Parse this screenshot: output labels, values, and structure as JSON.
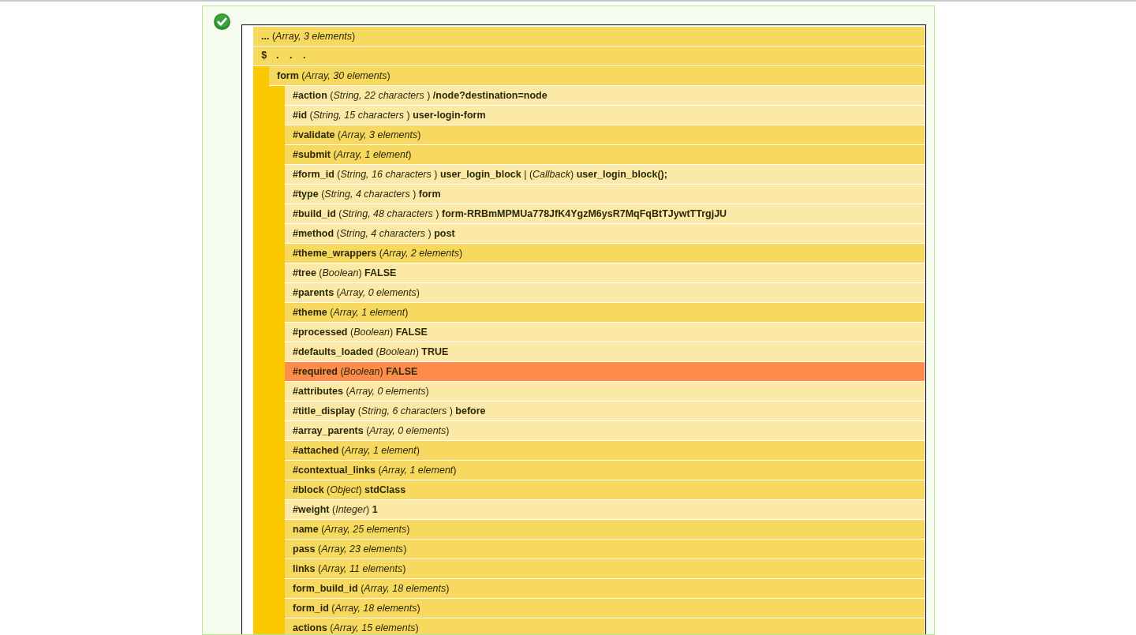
{
  "status": {
    "kind": "success"
  },
  "tree": [
    {
      "label": "**...** (*Array, 3 elements*)",
      "kind": "expandable",
      "highlighted": false
    },
    {
      "label": "$ . . .",
      "kind": "path",
      "highlighted": false,
      "children": [
        {
          "label": "**form** (*Array, 30 elements*)",
          "kind": "expandable",
          "highlighted": false,
          "children": [
            {
              "label": "**#action** (*String, 22 characters* ) **/node?destination=node**",
              "kind": "value",
              "highlighted": false
            },
            {
              "label": "**#id** (*String, 15 characters* ) **user-login-form**",
              "kind": "value",
              "highlighted": false
            },
            {
              "label": "**#validate** (*Array, 3 elements*)",
              "kind": "expandable",
              "highlighted": false
            },
            {
              "label": "**#submit** (*Array, 1 element*)",
              "kind": "expandable",
              "highlighted": false
            },
            {
              "label": "**#form_id** (*String, 16 characters* ) **user_login_block** | (*Callback*) **user_login_block();**",
              "kind": "value",
              "highlighted": false
            },
            {
              "label": "**#type** (*String, 4 characters* ) **form**",
              "kind": "value",
              "highlighted": false
            },
            {
              "label": "**#build_id** (*String, 48 characters* ) **form-RRBmMPMUa778JfK4YgzM6ysR7MqFqBtTJywtTTrgjJU**",
              "kind": "value",
              "highlighted": false
            },
            {
              "label": "**#method** (*String, 4 characters* ) **post**",
              "kind": "value",
              "highlighted": false
            },
            {
              "label": "**#theme_wrappers** (*Array, 2 elements*)",
              "kind": "expandable",
              "highlighted": false
            },
            {
              "label": "**#tree** (*Boolean*) **FALSE**",
              "kind": "value",
              "highlighted": false
            },
            {
              "label": "**#parents** (*Array, 0 elements*)",
              "kind": "value",
              "highlighted": false
            },
            {
              "label": "**#theme** (*Array, 1 element*)",
              "kind": "expandable",
              "highlighted": false
            },
            {
              "label": "**#processed** (*Boolean*) **FALSE**",
              "kind": "value",
              "highlighted": false
            },
            {
              "label": "**#defaults_loaded** (*Boolean*) **TRUE**",
              "kind": "value",
              "highlighted": false
            },
            {
              "label": "**#required** (*Boolean*) **FALSE**",
              "kind": "value",
              "highlighted": true
            },
            {
              "label": "**#attributes** (*Array, 0 elements*)",
              "kind": "value",
              "highlighted": false
            },
            {
              "label": "**#title_display** (*String, 6 characters* ) **before**",
              "kind": "value",
              "highlighted": false
            },
            {
              "label": "**#array_parents** (*Array, 0 elements*)",
              "kind": "value",
              "highlighted": false
            },
            {
              "label": "**#attached** (*Array, 1 element*)",
              "kind": "expandable",
              "highlighted": false
            },
            {
              "label": "**#contextual_links** (*Array, 1 element*)",
              "kind": "expandable",
              "highlighted": false
            },
            {
              "label": "**#block** (*Object*) **stdClass**",
              "kind": "expandable",
              "highlighted": false
            },
            {
              "label": "**#weight** (*Integer*) **1**",
              "kind": "value",
              "highlighted": false
            },
            {
              "label": "**name** (*Array, 25 elements*)",
              "kind": "expandable",
              "highlighted": false
            },
            {
              "label": "**pass** (*Array, 23 elements*)",
              "kind": "expandable",
              "highlighted": false
            },
            {
              "label": "**links** (*Array, 11 elements*)",
              "kind": "expandable",
              "highlighted": false
            },
            {
              "label": "**form_build_id** (*Array, 18 elements*)",
              "kind": "expandable",
              "highlighted": false
            },
            {
              "label": "**form_id** (*Array, 18 elements*)",
              "kind": "expandable",
              "highlighted": false
            },
            {
              "label": "**actions** (*Array, 15 elements*)",
              "kind": "expandable",
              "highlighted": false
            }
          ]
        }
      ]
    }
  ]
}
